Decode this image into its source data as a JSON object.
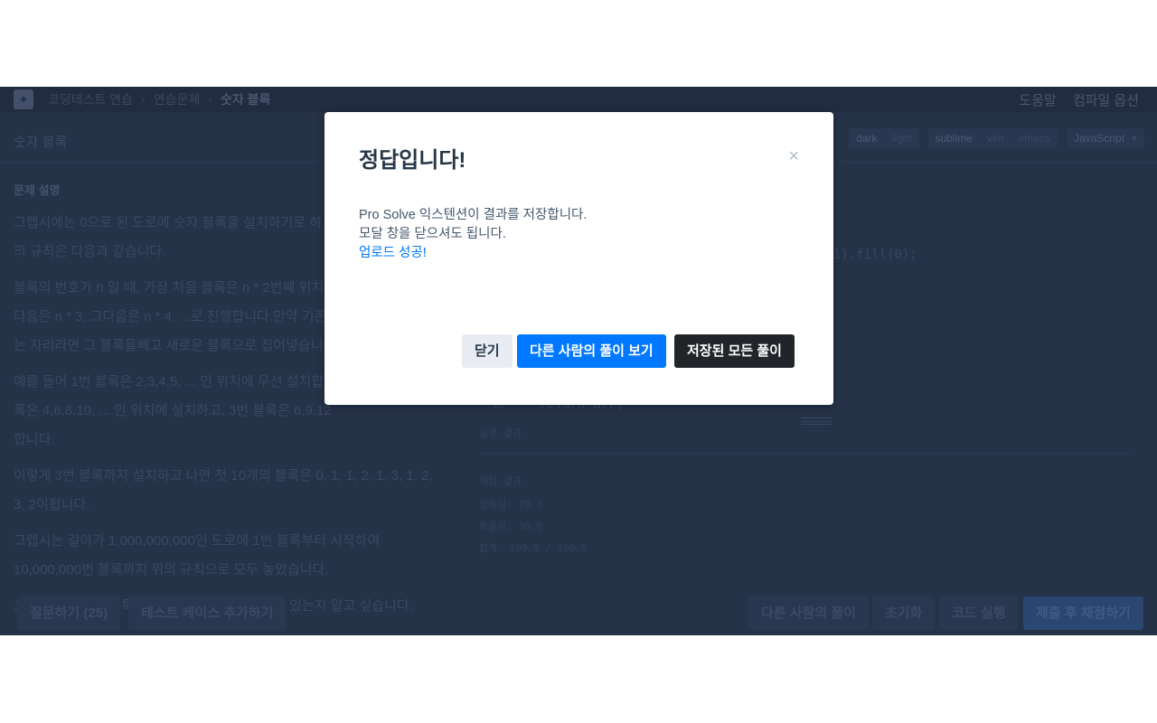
{
  "header": {
    "logo": "programmers-logo",
    "breadcrumb": [
      "코딩테스트 연습",
      "연습문제",
      "숫자 블록"
    ],
    "links": [
      "도움말",
      "컴파일 옵션"
    ]
  },
  "problem": {
    "title": "숫자 블록"
  },
  "editor_options": {
    "theme": [
      "dark",
      "light"
    ],
    "keymap": [
      "sublime",
      "vim",
      "emacs"
    ],
    "language": "JavaScript"
  },
  "description": {
    "heading": "문제 설명",
    "paragraphs": [
      "그렙시에는 0으로 된 도로에 숫자 블록을 설치하기로 하",
      "의 규칙은 다음과 같습니다.",
      "블록의 번호가 n 일 때, 가장 처음 블록은 n * 2번째 위치",
      "다음은 n * 3, 그다음은 n * 4, ...로 진행합니다.만약 기존",
      "는 자리라면 그 블록을빼고 새로운 블록으로 집어넣습니다",
      "예를 들어 1번 블록은 2,3,4,5, ... 인 위치에 우선 설치합",
      "록은 4,6,8,10, ... 인 위치에 설치하고, 3번 블록은 6,9,12",
      "합니다.",
      "이렇게 3번 블록까지 설치하고 나면 첫 10개의 블록은 0, 1, 1, 2, 1, 3, 1, 2,",
      "3, 2이됩니다.",
      "그렙시는 길이가 1,000,000,000인 도로에 1번 블록부터 시작하여",
      "10,000,000번 블록까지 위의 규칙으로 모두 놓았습니다.",
      "그렙시의 시장님은 특정 구간의 어떤 블록이 깔려 있는지 알고 싶습니다."
    ]
  },
  "code": {
    "fragment": "1).fill(0);",
    "line_number": "10",
    "last_line": "return arr;"
  },
  "results": {
    "run_label": "실행 결과",
    "grade_label": "채점 결과",
    "accuracy": "정확성: 70.0",
    "efficiency": "효율성: 30.0",
    "total": "합계: 100.0 / 100.0"
  },
  "footer": {
    "ask": "질문하기 (25)",
    "add_tc": "테스트 케이스 추가하기",
    "others": "다른 사람의 풀이",
    "reset": "초기화",
    "run": "코드 실행",
    "submit": "제출 후 채점하기"
  },
  "modal": {
    "title": "정답입니다!",
    "close_icon": "×",
    "lines": [
      "Pro Solve 익스텐션이 결과를 저장합니다.",
      "모달 창을 닫으셔도 됩니다."
    ],
    "success": "업로드 성공!",
    "buttons": {
      "close": "닫기",
      "view_others": "다른 사람의 풀이 보기",
      "saved_all": "저장된 모든 풀이"
    }
  },
  "colors": {
    "primary": "#0078ff",
    "dark_button": "#212529",
    "overlay_bg": "#263248"
  }
}
